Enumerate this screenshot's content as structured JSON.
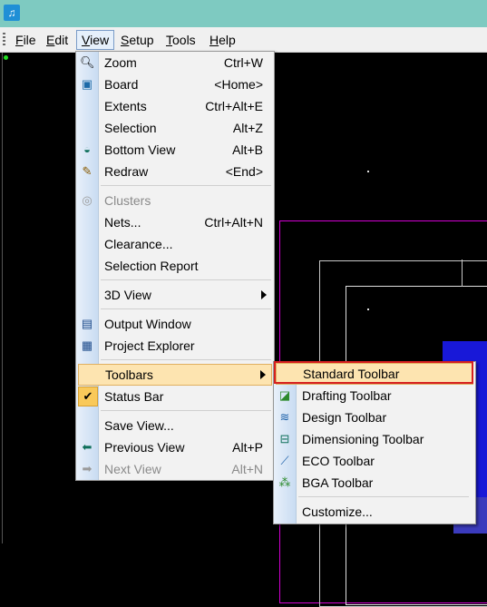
{
  "app": {
    "icon_name": "pads-app-icon",
    "titlebar_color": "#7ecac1"
  },
  "menubar": {
    "items": [
      {
        "label": "File",
        "ul": "F",
        "rest": "ile"
      },
      {
        "label": "Edit",
        "ul": "E",
        "rest": "dit"
      },
      {
        "label": "View",
        "ul": "V",
        "rest": "iew"
      },
      {
        "label": "Setup",
        "ul": "S",
        "rest": "etup"
      },
      {
        "label": "Tools",
        "ul": "T",
        "rest": "ools"
      },
      {
        "label": "Help",
        "ul": "H",
        "rest": "elp"
      }
    ]
  },
  "view_menu": {
    "items": [
      {
        "label": "Zoom",
        "shortcut": "Ctrl+W",
        "icon": "zoom-icon"
      },
      {
        "label": "Board",
        "shortcut": "<Home>",
        "icon": "board-icon"
      },
      {
        "label": "Extents",
        "shortcut": "Ctrl+Alt+E"
      },
      {
        "label": "Selection",
        "shortcut": "Alt+Z"
      },
      {
        "label": "Bottom View",
        "shortcut": "Alt+B",
        "icon": "bottom-view-icon"
      },
      {
        "label": "Redraw",
        "shortcut": "<End>",
        "icon": "redraw-icon"
      },
      {
        "label": "Clusters",
        "shortcut": "",
        "icon": "clusters-icon",
        "disabled": true
      },
      {
        "label": "Nets...",
        "shortcut": "Ctrl+Alt+N"
      },
      {
        "label": "Clearance...",
        "shortcut": ""
      },
      {
        "label": "Selection Report",
        "shortcut": ""
      },
      {
        "label": "3D View",
        "shortcut": "",
        "submenu": true
      },
      {
        "label": "Output Window",
        "shortcut": "",
        "icon": "output-window-icon"
      },
      {
        "label": "Project Explorer",
        "shortcut": "",
        "icon": "project-explorer-icon"
      },
      {
        "label": "Toolbars",
        "shortcut": "",
        "submenu": true,
        "highlighted": true
      },
      {
        "label": "Status Bar",
        "shortcut": "",
        "checked": true
      },
      {
        "label": "Save View...",
        "shortcut": ""
      },
      {
        "label": "Previous View",
        "shortcut": "Alt+P",
        "icon": "previous-view-icon"
      },
      {
        "label": "Next View",
        "shortcut": "Alt+N",
        "icon": "next-view-icon",
        "disabled": true
      }
    ]
  },
  "toolbars_submenu": {
    "items": [
      {
        "label": "Standard Toolbar",
        "highlighted": true
      },
      {
        "label": "Drafting Toolbar",
        "icon": "drafting-toolbar-icon"
      },
      {
        "label": "Design Toolbar",
        "icon": "design-toolbar-icon"
      },
      {
        "label": "Dimensioning Toolbar",
        "icon": "dimensioning-toolbar-icon"
      },
      {
        "label": "ECO Toolbar",
        "icon": "eco-toolbar-icon"
      },
      {
        "label": "BGA Toolbar",
        "icon": "bga-toolbar-icon"
      },
      {
        "label": "Customize..."
      }
    ]
  },
  "colors": {
    "highlight": "#fde4b0",
    "annotation_box": "#d62020",
    "board_outline": "#d400d4",
    "copper": "#1818d8"
  }
}
